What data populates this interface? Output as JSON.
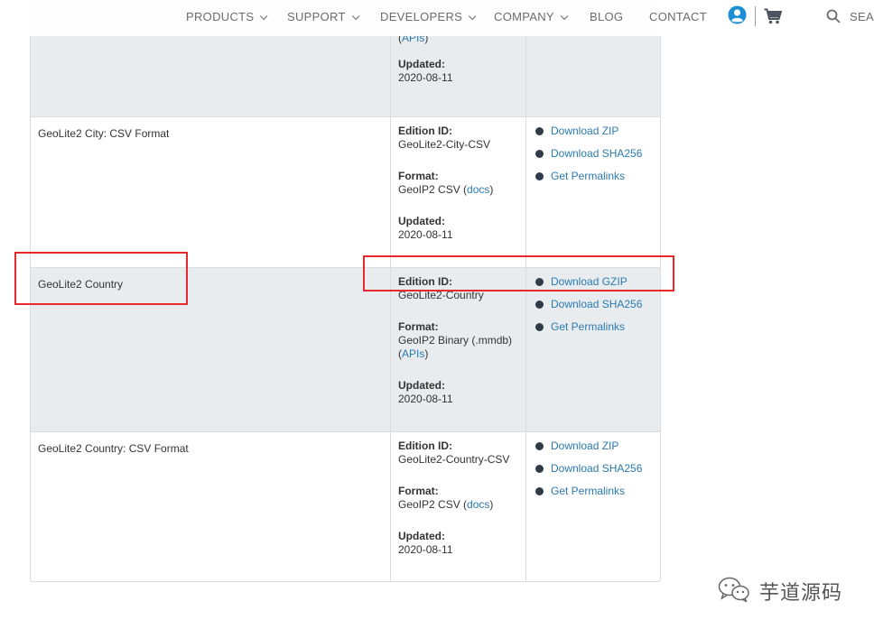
{
  "nav": {
    "items": [
      {
        "label": "PRODUCTS",
        "dropdown": true
      },
      {
        "label": "SUPPORT",
        "dropdown": true
      },
      {
        "label": "DEVELOPERS",
        "dropdown": true
      },
      {
        "label": "COMPANY",
        "dropdown": true
      },
      {
        "label": "BLOG",
        "dropdown": false
      },
      {
        "label": "CONTACT",
        "dropdown": false
      }
    ],
    "search_label": "SEAR",
    "account_icon": "user-circle-icon",
    "cart_icon": "shopping-cart-icon",
    "search_icon": "search-icon",
    "account_color": "#1a8fd6"
  },
  "table": {
    "rows": [
      {
        "name": "",
        "shaded": true,
        "partial": true,
        "format_api_suffix": "APIs",
        "updated_label": "Updated:",
        "updated": "2020-08-11"
      },
      {
        "name": "GeoLite2 City: CSV Format",
        "shaded": false,
        "edition_label": "Edition ID:",
        "edition": "GeoLite2-City-CSV",
        "format_label": "Format:",
        "format": "GeoIP2 CSV",
        "format_link": "docs",
        "updated_label": "Updated:",
        "updated": "2020-08-11",
        "links": [
          "Download ZIP",
          "Download SHA256",
          "Get Permalinks"
        ]
      },
      {
        "name": "GeoLite2 Country",
        "shaded": true,
        "edition_label": "Edition ID:",
        "edition": "GeoLite2-Country",
        "format_label": "Format:",
        "format": "GeoIP2 Binary (.mmdb)",
        "format_link": "APIs",
        "updated_label": "Updated:",
        "updated": "2020-08-11",
        "links": [
          "Download GZIP",
          "Download SHA256",
          "Get Permalinks"
        ]
      },
      {
        "name": "GeoLite2 Country: CSV Format",
        "shaded": false,
        "edition_label": "Edition ID:",
        "edition": "GeoLite2-Country-CSV",
        "format_label": "Format:",
        "format": "GeoIP2 CSV",
        "format_link": "docs",
        "updated_label": "Updated:",
        "updated": "2020-08-11",
        "links": [
          "Download ZIP",
          "Download SHA256",
          "Get Permalinks"
        ]
      }
    ]
  },
  "colors": {
    "link": "#2a7ab0",
    "annotation": "#e8282c",
    "row_shade": "#e9ecef",
    "bullet": "#2f3b48"
  },
  "watermark": {
    "text": "芋道源码",
    "icon": "wechat-icon"
  }
}
